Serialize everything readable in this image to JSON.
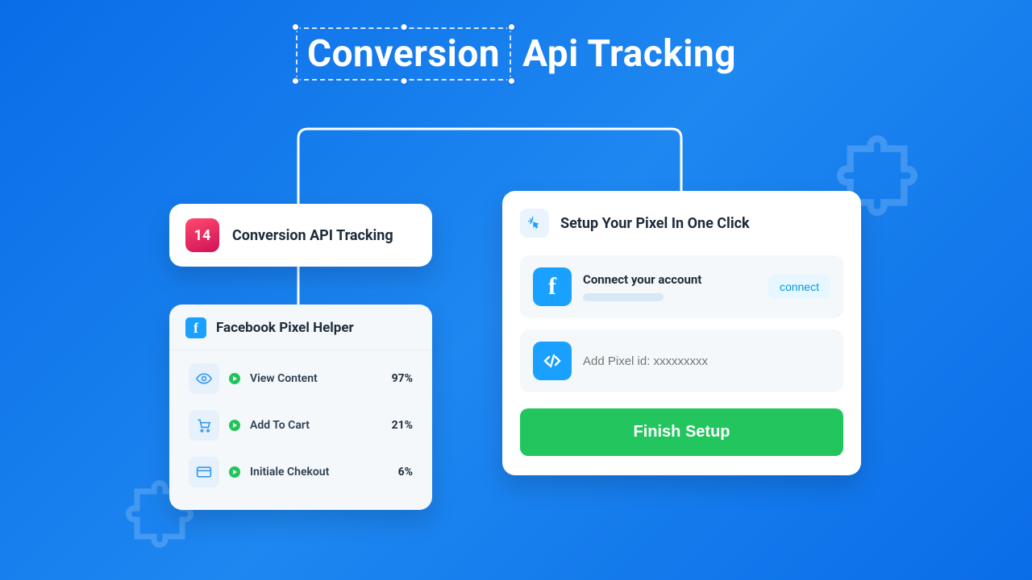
{
  "heading": {
    "highlight": "Conversion",
    "rest": "Api Tracking"
  },
  "card1": {
    "badge": "14",
    "title": "Conversion API Tracking"
  },
  "pixelHelper": {
    "title": "Facebook Pixel Helper",
    "rows": [
      {
        "name": "View Content",
        "pct": "97%"
      },
      {
        "name": "Add To Cart",
        "pct": "21%"
      },
      {
        "name": "Initiale Chekout",
        "pct": "6%"
      }
    ]
  },
  "setup": {
    "title": "Setup Your Pixel In One Click",
    "connect": {
      "label": "Connect your account",
      "button": "connect"
    },
    "pixel": {
      "placeholder": "Add Pixel id: xxxxxxxxx"
    },
    "finish": "Finish Setup"
  }
}
